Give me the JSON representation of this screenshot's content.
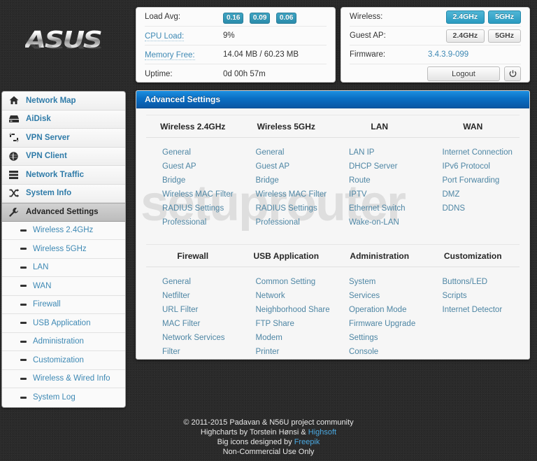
{
  "brand": {
    "logo_text": "ASUS",
    "logo_alt": "asus-logo"
  },
  "sidebar": {
    "items": [
      {
        "label": "Network Map",
        "icon": "home-icon",
        "name": "network-map"
      },
      {
        "label": "AiDisk",
        "icon": "disk-icon",
        "name": "aidisk"
      },
      {
        "label": "VPN Server",
        "icon": "exchange-icon",
        "name": "vpn-server"
      },
      {
        "label": "VPN Client",
        "icon": "globe-icon",
        "name": "vpn-client"
      },
      {
        "label": "Network Traffic",
        "icon": "server-icon",
        "name": "network-traffic"
      },
      {
        "label": "System Info",
        "icon": "shuffle-icon",
        "name": "system-info"
      },
      {
        "label": "Advanced Settings",
        "icon": "wrench-icon",
        "name": "advanced-settings",
        "active": true
      }
    ],
    "subitems": [
      {
        "label": "Wireless 2.4GHz",
        "name": "wireless-24ghz"
      },
      {
        "label": "Wireless 5GHz",
        "name": "wireless-5ghz"
      },
      {
        "label": "LAN",
        "name": "lan"
      },
      {
        "label": "WAN",
        "name": "wan"
      },
      {
        "label": "Firewall",
        "name": "firewall"
      },
      {
        "label": "USB Application",
        "name": "usb-application"
      },
      {
        "label": "Administration",
        "name": "administration"
      },
      {
        "label": "Customization",
        "name": "customization"
      },
      {
        "label": "Wireless & Wired Info",
        "name": "wireless-wired-info"
      },
      {
        "label": "System Log",
        "name": "system-log"
      }
    ]
  },
  "status_left": {
    "load_avg_label": "Load Avg:",
    "load_avg": [
      "0.16",
      "0.09",
      "0.06"
    ],
    "cpu_load_label": "CPU Load:",
    "cpu_load_value": "9%",
    "memory_free_label": "Memory Free:",
    "memory_free_value": "14.04 MB / 60.23 MB",
    "uptime_label": "Uptime:",
    "uptime_value": "0d 00h 57m"
  },
  "status_right": {
    "wireless_label": "Wireless:",
    "wireless_24_label": "2.4GHz",
    "wireless_5_label": "5GHz",
    "guest_ap_label": "Guest AP:",
    "guest_24_label": "2.4GHz",
    "guest_5_label": "5GHz",
    "firmware_label": "Firmware:",
    "firmware_value": "3.4.3.9-099",
    "logout_label": "Logout",
    "power_icon": "power-icon"
  },
  "main": {
    "panel_title": "Advanced Settings",
    "watermark": "setuprouter",
    "sections": [
      {
        "headers": [
          "Wireless 2.4GHz",
          "Wireless 5GHz",
          "LAN",
          "WAN"
        ],
        "columns": [
          [
            "General",
            "Guest AP",
            "Bridge",
            "Wireless MAC Filter",
            "RADIUS Settings",
            "Professional"
          ],
          [
            "General",
            "Guest AP",
            "Bridge",
            "Wireless MAC Filter",
            "RADIUS Settings",
            "Professional"
          ],
          [
            "LAN IP",
            "DHCP Server",
            "Route",
            "IPTV",
            "Ethernet Switch",
            "Wake-on-LAN"
          ],
          [
            "Internet Connection",
            "IPv6 Protocol",
            "Port Forwarding",
            "DMZ",
            "DDNS"
          ]
        ]
      },
      {
        "headers": [
          "Firewall",
          "USB Application",
          "Administration",
          "Customization"
        ],
        "columns": [
          [
            "General",
            "Netfilter",
            "URL Filter",
            "MAC Filter",
            "Network Services",
            "Filter"
          ],
          [
            "Common Setting",
            "Network",
            "Neighborhood Share",
            "FTP Share",
            "Modem",
            "Printer"
          ],
          [
            "System",
            "Services",
            "Operation Mode",
            "Firmware Upgrade",
            "Settings",
            "Console"
          ],
          [
            "Buttons/LED",
            "Scripts",
            "Internet Detector"
          ]
        ]
      }
    ]
  },
  "footer": {
    "line1": "© 2011-2015 Padavan & N56U project community",
    "line2_pre": "Highcharts by Torstein Hønsi & ",
    "line2_link": "Highsoft",
    "line3_pre": "Big icons designed by ",
    "line3_link": "Freepik",
    "line4": "Non-Commercial Use Only"
  },
  "colors": {
    "accent_blue": "#0a6fc4",
    "link_blue": "#4e86a4",
    "nav_blue": "#2f7ba8",
    "badge_teal": "#2b8cab",
    "active_btn": "#2a9bc0"
  }
}
